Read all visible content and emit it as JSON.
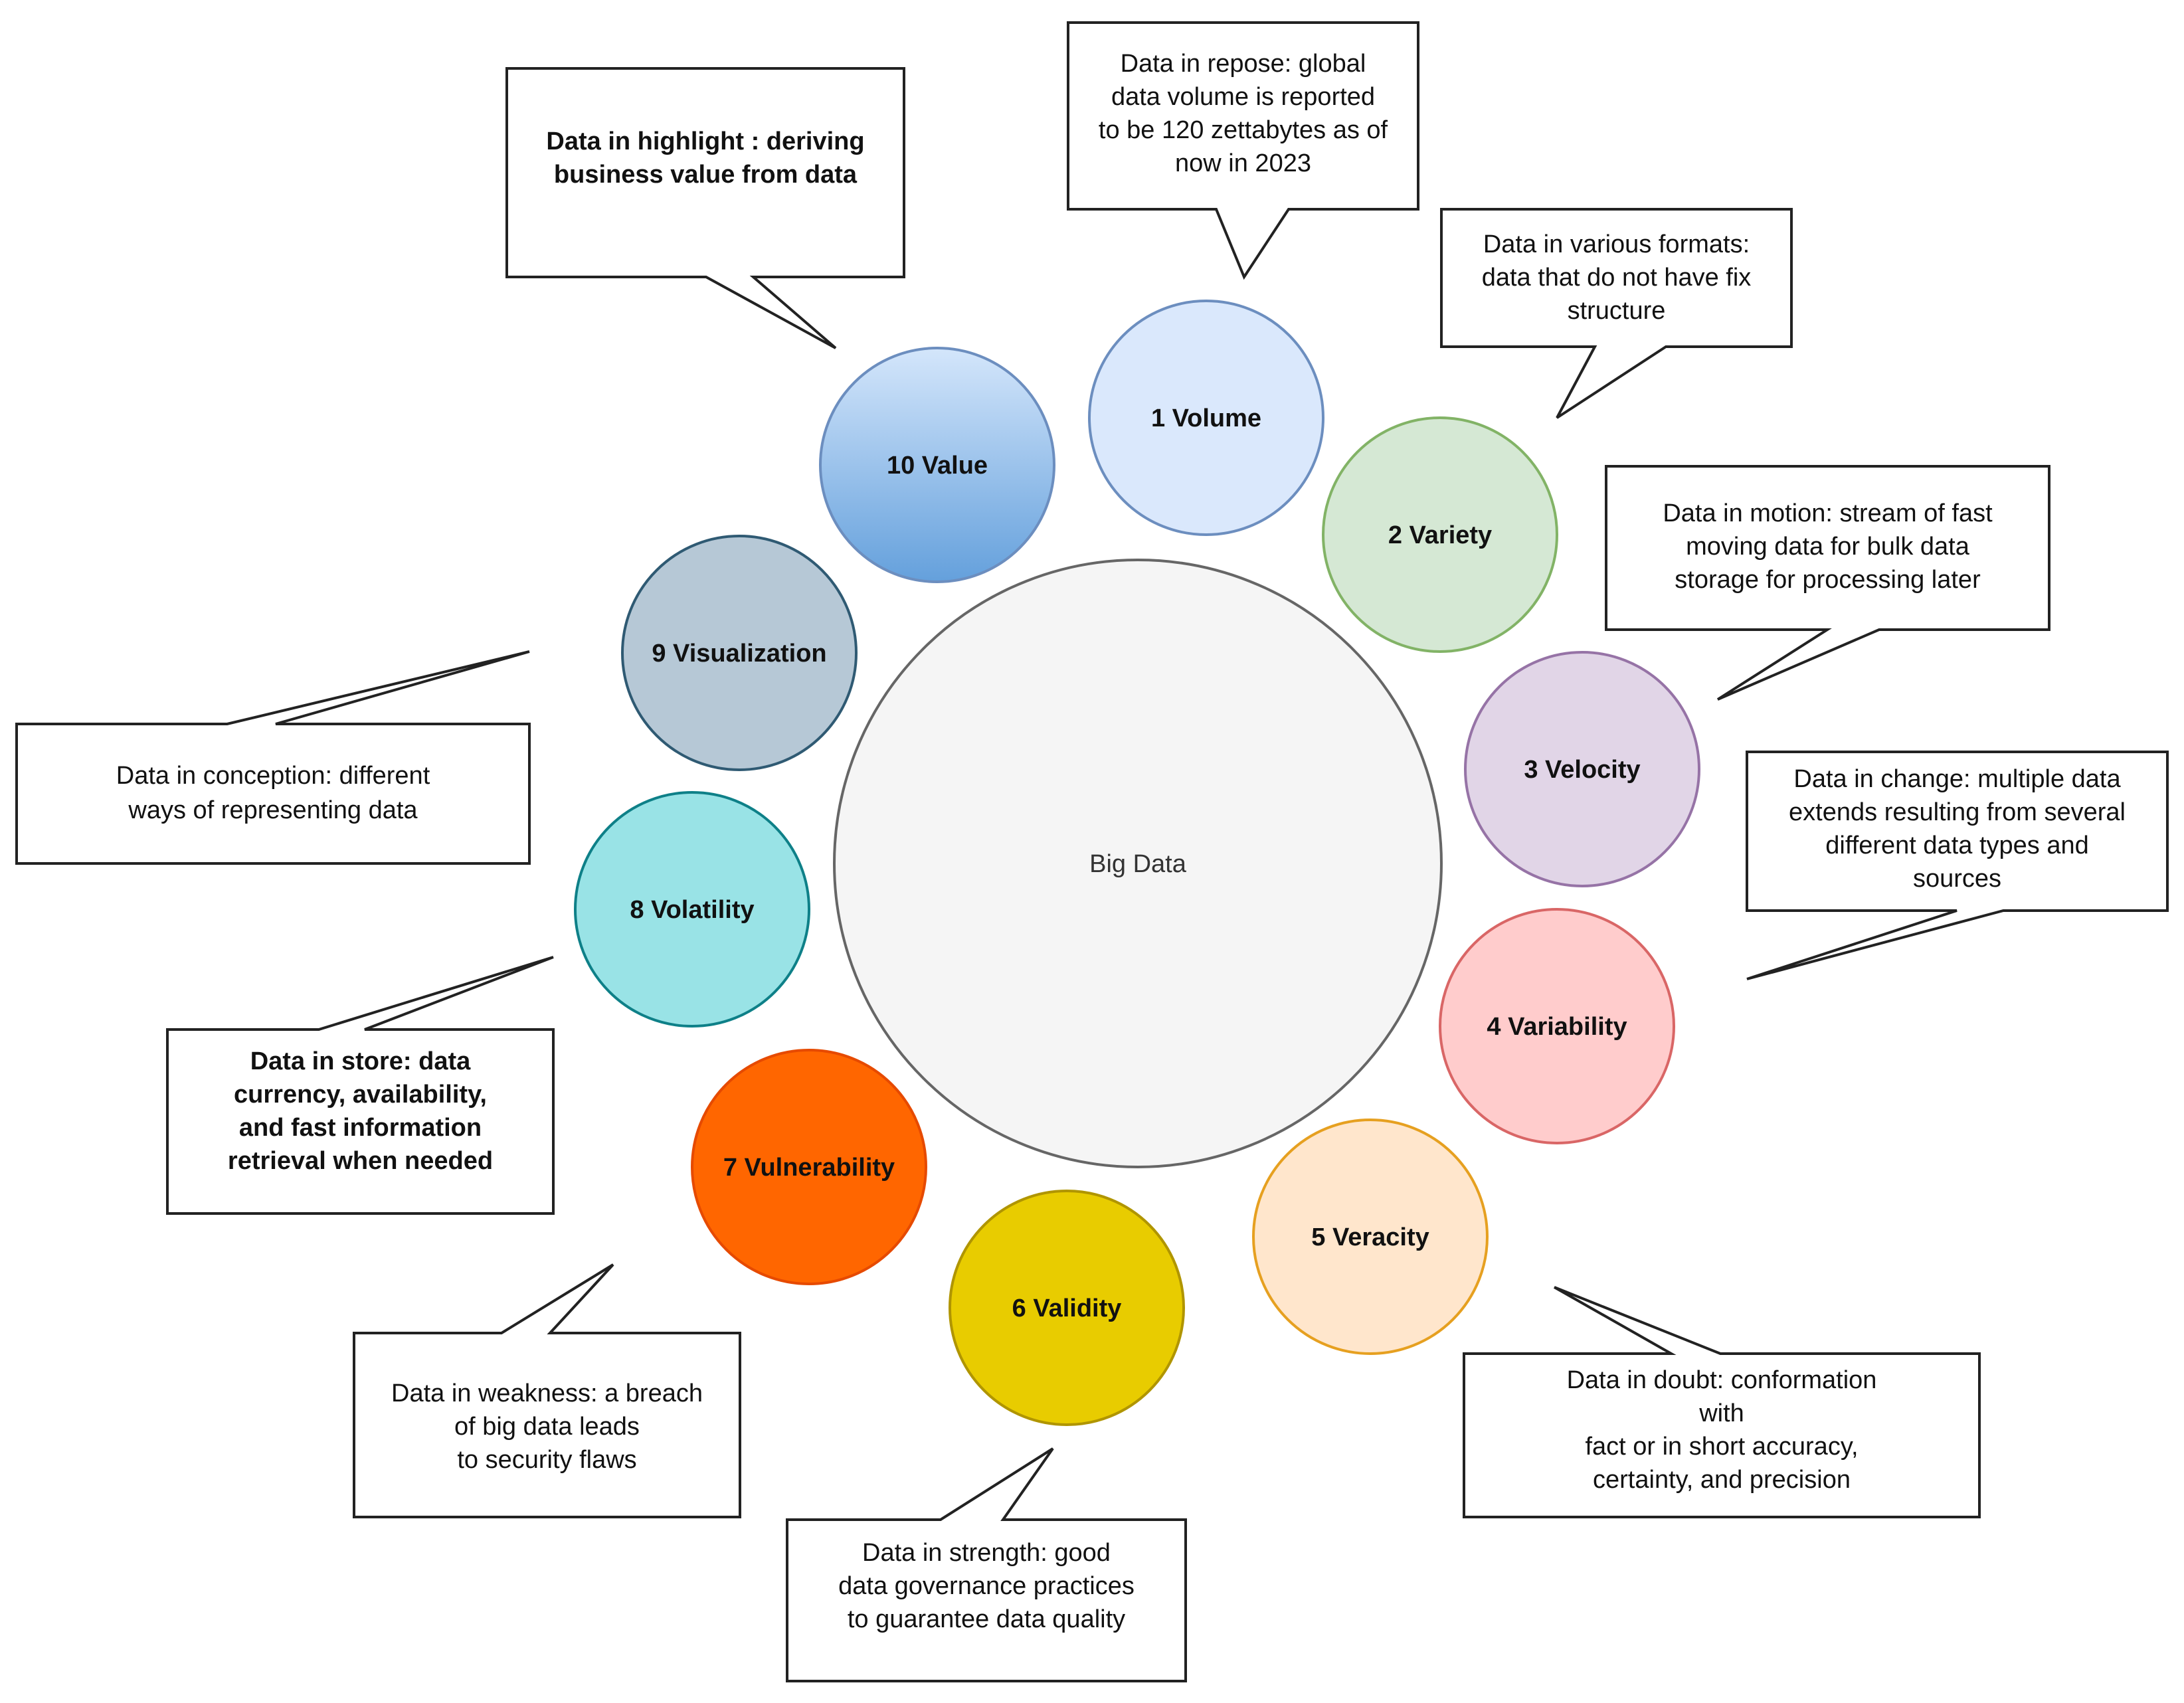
{
  "diagram": {
    "title": "Big Data",
    "center": {
      "label": "Big Data",
      "fill": "#f5f5f5",
      "stroke": "#666666"
    },
    "nodes": [
      {
        "id": "volume",
        "label": "1 Volume",
        "fill": "#dae8fc",
        "stroke": "#6c8ebf",
        "callout": [
          "Data in repose: global",
          "data volume is reported",
          "to be 120 zettabytes as of",
          "now in 2023"
        ]
      },
      {
        "id": "variety",
        "label": "2 Variety",
        "fill": "#d5e8d4",
        "stroke": "#82b366",
        "callout": [
          "Data in various formats:",
          "data that do not have fix",
          "structure"
        ]
      },
      {
        "id": "velocity",
        "label": "3 Velocity",
        "fill": "#e1d5e7",
        "stroke": "#9673a6",
        "callout": [
          "Data in motion: stream of fast",
          "moving data for bulk data",
          "storage for processing later"
        ]
      },
      {
        "id": "variability",
        "label": "4 Variability",
        "fill": "#ffcccc",
        "stroke": "#d96666",
        "callout": [
          "Data in change: multiple data",
          "extends resulting from several",
          "different  data types and",
          "sources"
        ]
      },
      {
        "id": "veracity",
        "label": "5 Veracity",
        "fill": "#ffe6cc",
        "stroke": "#e6a020",
        "callout": [
          "Data in doubt: conformation",
          "with",
          "fact or in short accuracy,",
          "certainty, and precision"
        ]
      },
      {
        "id": "validity",
        "label": "6 Validity",
        "fill": "#e8cc00",
        "stroke": "#b09500",
        "callout": [
          "Data in strength: good",
          "data governance practices",
          "to guarantee data quality"
        ]
      },
      {
        "id": "vulnerability",
        "label": "7 Vulnerability",
        "fill": "#ff6600",
        "stroke": "#e64a00",
        "callout": [
          "Data in weakness: a breach",
          "of big data leads",
          "to security flaws"
        ]
      },
      {
        "id": "volatility",
        "label": "8 Volatility",
        "fill": "#99e3e6",
        "stroke": "#0e8088",
        "callout": [
          "Data in store: data",
          "currency, availability,",
          "and  fast information",
          "retrieval when needed"
        ]
      },
      {
        "id": "visualization",
        "label": "9 Visualization",
        "fill": "#b6c8d6",
        "stroke": "#2f5a73",
        "callout": [
          "Data in conception: different",
          "ways of representing data"
        ]
      },
      {
        "id": "value",
        "label": "10 Value",
        "fill_top": "#d4e6fb",
        "fill_bottom": "#64a0dc",
        "stroke": "#6c8ebf",
        "callout": [
          "Data in highlight : deriving",
          "business value from data"
        ]
      }
    ]
  }
}
